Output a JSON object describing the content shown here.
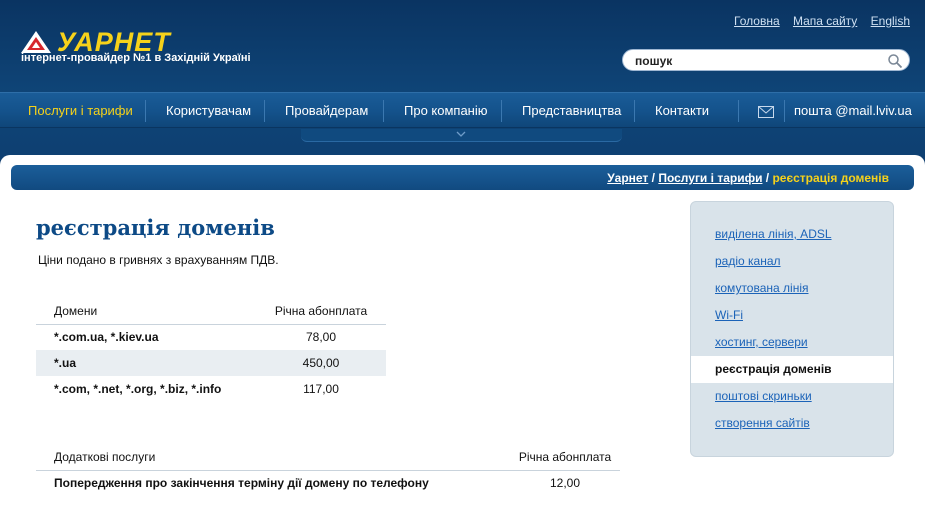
{
  "header": {
    "logo_text": "УАРНЕТ",
    "tagline": "інтернет-провайдер №1 в Західній Україні",
    "top_links": [
      "Головна",
      "Мапа сайту",
      "English"
    ],
    "search": {
      "value": "пошук"
    }
  },
  "nav": {
    "items": [
      {
        "label": "Послуги і тарифи",
        "active": true
      },
      {
        "label": "Користувачам",
        "active": false
      },
      {
        "label": "Провайдерам",
        "active": false
      },
      {
        "label": "Про компанію",
        "active": false
      },
      {
        "label": "Представництва",
        "active": false
      },
      {
        "label": "Контакти",
        "active": false
      }
    ],
    "mail_label": "пошта @mail.lviv.ua"
  },
  "breadcrumb": {
    "items": [
      "Уарнет",
      "Послуги і тарифи"
    ],
    "current": "реєстрація доменів"
  },
  "page": {
    "title": "реєстрація доменів",
    "intro": "Ціни подано в гривнях з врахуванням ПДВ."
  },
  "domains_table": {
    "headers": [
      "Домени",
      "Річна абонплата"
    ],
    "rows": [
      [
        "*.com.ua, *.kiev.ua",
        "78,00"
      ],
      [
        "*.ua",
        "450,00"
      ],
      [
        "*.com, *.net, *.org, *.biz, *.info",
        "117,00"
      ]
    ]
  },
  "extra_table": {
    "headers": [
      "Додаткові послуги",
      "Річна абонплата"
    ],
    "rows": [
      [
        "Попередження про закінчення терміну дії домену по телефону",
        "12,00"
      ]
    ]
  },
  "sidebar": {
    "items": [
      {
        "label": "виділена лінія, ADSL",
        "active": false
      },
      {
        "label": "радіо канал",
        "active": false
      },
      {
        "label": "комутована лінія",
        "active": false
      },
      {
        "label": "Wi-Fi",
        "active": false
      },
      {
        "label": "хостинг, сервери",
        "active": false
      },
      {
        "label": "реєстрація доменів",
        "active": true
      },
      {
        "label": "поштові скриньки",
        "active": false
      },
      {
        "label": "створення сайтів",
        "active": false
      }
    ]
  },
  "colors": {
    "header_bg": "#0d3b6c",
    "accent_yellow": "#f6d21a",
    "link_blue": "#1b63b8",
    "title_blue": "#0d4a86",
    "sidebar_bg": "#d9e3ea"
  }
}
